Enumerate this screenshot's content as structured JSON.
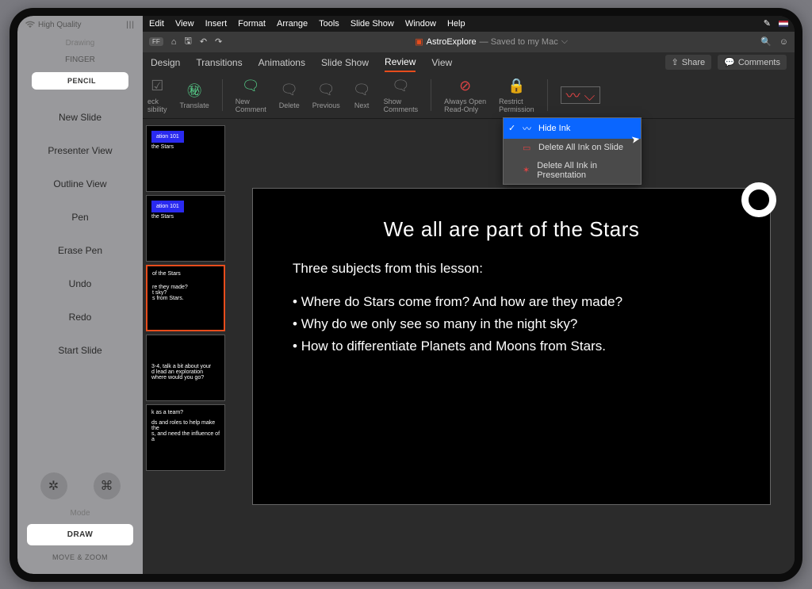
{
  "overlay": {
    "status": "High Quality",
    "section_drawing": "Drawing",
    "finger": "FINGER",
    "pencil": "PENCIL",
    "items": [
      "New Slide",
      "Presenter View",
      "Outline View",
      "Pen",
      "Erase Pen",
      "Undo",
      "Redo",
      "Start Slide"
    ],
    "mode_label": "Mode",
    "draw_label": "DRAW",
    "movezoom": "MOVE & ZOOM"
  },
  "menu": {
    "items": [
      "Edit",
      "View",
      "Insert",
      "Format",
      "Arrange",
      "Tools",
      "Slide Show",
      "Window",
      "Help"
    ]
  },
  "doc": {
    "name": "AstroExplore",
    "location": "— Saved to my Mac"
  },
  "tabs": {
    "items": [
      "Design",
      "Transitions",
      "Animations",
      "Slide Show",
      "Review",
      "View"
    ],
    "active_index": 4
  },
  "actions": {
    "share": "Share",
    "comments": "Comments"
  },
  "ribbon": {
    "check": {
      "l1": "eck",
      "l2": "sibility"
    },
    "translate": "Translate",
    "newcomment": {
      "l1": "New",
      "l2": "Comment"
    },
    "delete": "Delete",
    "previous": "Previous",
    "next": "Next",
    "showcomments": {
      "l1": "Show",
      "l2": "Comments"
    },
    "alwaysopen": {
      "l1": "Always Open",
      "l2": "Read-Only"
    },
    "restrict": {
      "l1": "Restrict",
      "l2": "Permission"
    }
  },
  "dropdown": {
    "hide": "Hide Ink",
    "delslide": "Delete All Ink on Slide",
    "delpres": "Delete All Ink in Presentation"
  },
  "thumbs": [
    {
      "title": "ation 101",
      "sub": "the Stars",
      "blue": true
    },
    {
      "title": "ation 101",
      "sub": "the Stars",
      "blue": true
    },
    {
      "title": "of the Stars",
      "lines": [
        "re they made?",
        "t sky?",
        "s from Stars."
      ],
      "selected": true
    },
    {
      "title": "",
      "lines": [
        "3-4, talk a bit about your",
        "d lead an exploration",
        "where would you go?"
      ]
    },
    {
      "title": "k as a team?",
      "lines": [
        "ds and roles to help make the",
        "s, and need the influence of a"
      ]
    }
  ],
  "slide": {
    "title": "We all are   part of the Stars",
    "subtitle": "Three subjects from this lesson:",
    "bullets": [
      "Where do Stars come from? And how are they made?",
      "Why do we only see so many in the night sky?",
      "How to differentiate Planets and Moons from Stars."
    ]
  }
}
